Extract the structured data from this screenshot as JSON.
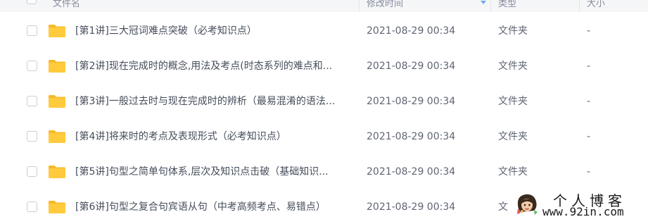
{
  "columns": {
    "name": "文件名",
    "modified": "修改时间",
    "type": "类型",
    "size": "大小"
  },
  "rows": [
    {
      "name": "[第1讲]三大冠词难点突破（必考知识点）",
      "modified": "2021-08-29 00:34",
      "type": "文件夹",
      "size": "-"
    },
    {
      "name": "[第2讲]现在完成时的概念,用法及考点(时态系列的难点和...",
      "modified": "2021-08-29 00:34",
      "type": "文件夹",
      "size": "-"
    },
    {
      "name": "[第3讲]一般过去时与现在完成时的辨析（最易混淆的语法...",
      "modified": "2021-08-29 00:34",
      "type": "文件夹",
      "size": "-"
    },
    {
      "name": "[第4讲]将来时的考点及表现形式（必考知识点）",
      "modified": "2021-08-29 00:34",
      "type": "文件夹",
      "size": "-"
    },
    {
      "name": "[第5讲]句型之简单句体系,层次及知识点击破（基础知识...",
      "modified": "2021-08-29 00:34",
      "type": "文件夹",
      "size": "-"
    },
    {
      "name": "[第6讲]句型之复合句宾语从句（中考高频考点、易错点）",
      "modified": "2021-08-29 00:34",
      "type": "文",
      "size": ""
    }
  ],
  "watermark": {
    "title": "个人博客",
    "url": "www.92in.com"
  },
  "colors": {
    "folder": "#ffcb3d",
    "folder_tab": "#f7b928",
    "accent": "#6aa9f5"
  },
  "icons": {
    "folder": "folder-icon",
    "sort": "sort-desc-arrow-icon"
  }
}
